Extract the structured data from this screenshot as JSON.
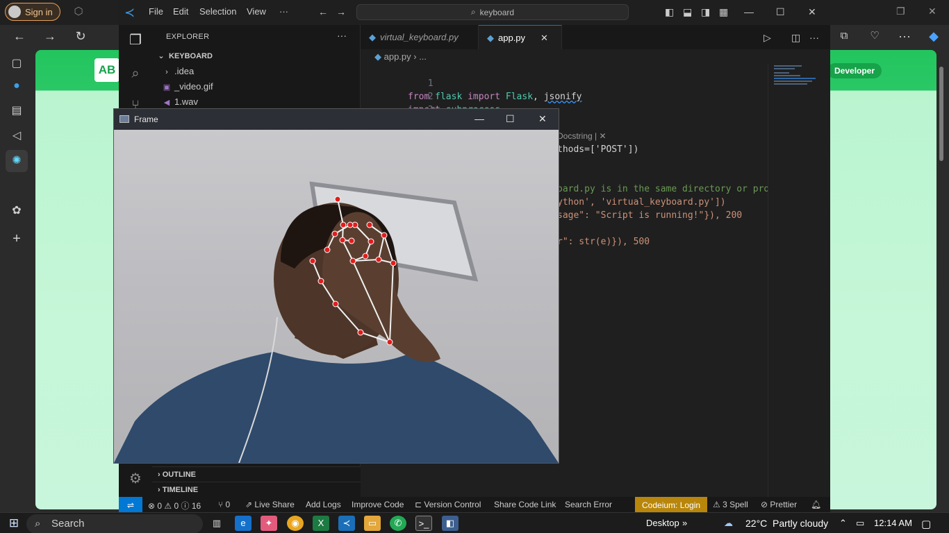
{
  "browser": {
    "signin_label": "Sign in",
    "page_logo": "AB",
    "developer_pill": "Developer"
  },
  "vscode": {
    "menu": [
      "File",
      "Edit",
      "Selection",
      "View",
      "···"
    ],
    "search_text": "keyboard",
    "explorer": {
      "header": "EXPLORER",
      "folder": "KEYBOARD",
      "items": [
        {
          "name": ".idea",
          "type": "folder"
        },
        {
          "name": "_video.gif",
          "type": "gif"
        },
        {
          "name": "1.wav",
          "type": "audio"
        }
      ],
      "outline": "OUTLINE",
      "timeline": "TIMELINE"
    },
    "tabs": [
      {
        "label": "virtual_keyboard.py",
        "active": false
      },
      {
        "label": "app.py",
        "active": true
      }
    ],
    "breadcrumb": "app.py › ...",
    "code_lines": [
      {
        "n": "1",
        "tokens": [
          [
            "kw",
            "from "
          ],
          [
            "mod",
            "flask "
          ],
          [
            "kw",
            "import "
          ],
          [
            "mod",
            "Flask"
          ],
          [
            "p",
            ", "
          ],
          [
            "p",
            "jsonify"
          ]
        ]
      },
      {
        "n": "2",
        "tokens": [
          [
            "kw",
            "import "
          ],
          [
            "mod",
            "subprocess"
          ]
        ]
      },
      {
        "n": "3",
        "tokens": []
      }
    ],
    "visible_code_fragments": [
      {
        "text": "Docstring | ✕",
        "kind": "cm"
      },
      {
        "text": "thods=['POST'])",
        "kind": "p"
      },
      {
        "text": "oard.py is in the same directory or pro",
        "kind": "cm"
      },
      {
        "text": "ython', 'virtual_keyboard.py'])",
        "kind": "str"
      },
      {
        "text": "sage\": \"Script is running!\"}), 200",
        "kind": "str"
      },
      {
        "text": "r\": str(e)}), 500",
        "kind": "str"
      }
    ],
    "status": {
      "problems": "⊗ 0 ⚠ 0 ⓘ 16",
      "ports": "⑂ 0",
      "items": [
        "Live Share",
        "Add Logs",
        "Improve Code",
        "Version Control",
        "Share Code Link",
        "Search Error"
      ],
      "codeium": "Codeium: Login",
      "spell": "3 Spell",
      "prettier": "Prettier"
    }
  },
  "frame": {
    "title": "Frame"
  },
  "taskbar": {
    "search": "Search",
    "desktop": "Desktop",
    "temperature": "22°C",
    "weather": "Partly cloudy",
    "time": "12:14 AM"
  }
}
